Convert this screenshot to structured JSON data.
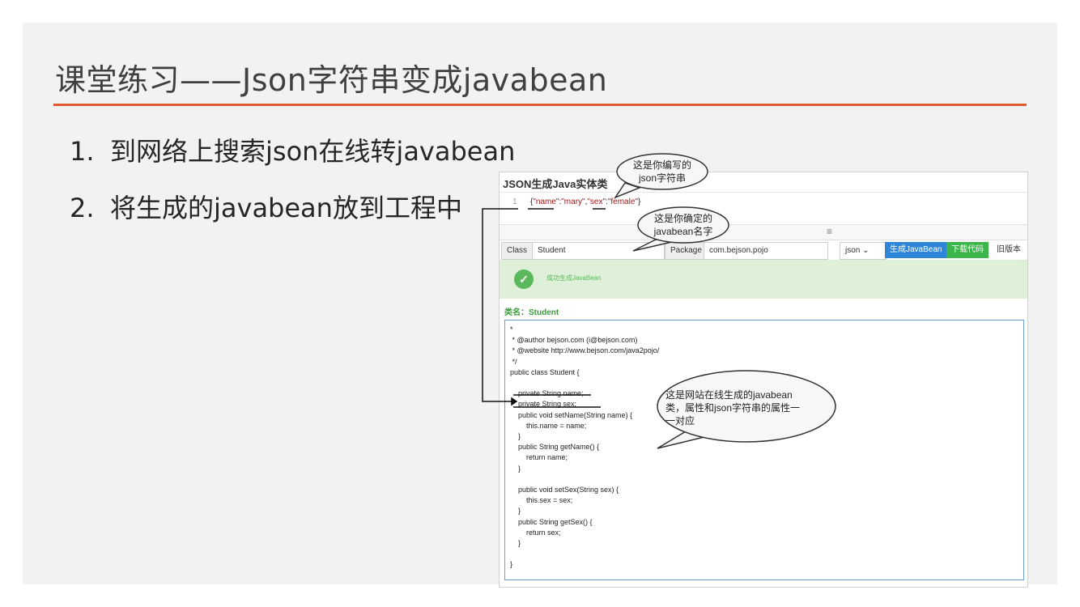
{
  "slide": {
    "title": "课堂练习——Json字符串变成javabean",
    "accent_color": "#e05a2b",
    "bullets": [
      {
        "num": "1.",
        "text": "到网络上搜索json在线转javabean"
      },
      {
        "num": "2.",
        "text": "将生成的javabean放到工程中"
      }
    ]
  },
  "screenshot": {
    "title": "JSON生成Java实体类",
    "editor": {
      "line_number": "1",
      "json_prefix": "{",
      "key1": "\"name\"",
      "sep1": ":",
      "val1": "\"mary\"",
      "comma": ",",
      "key2": "\"sex\"",
      "sep2": ":",
      "val2": "\"female\"",
      "json_suffix": "}"
    },
    "menu_icon": "hamburger-icon",
    "form": {
      "class_label": "Class",
      "class_value": "Student",
      "package_label": "Package",
      "package_value": "com.bejson.pojo",
      "type_select": "json",
      "generate_button": "生成JavaBean",
      "download_button": "下载代码",
      "old_version": "旧版本"
    },
    "success_message": "成功生成JavaBean",
    "class_name_label": "类名：Student",
    "code_lines": [
      "*",
      " * @author bejson.com (i@bejson.com)",
      " * @website http://www.bejson.com/java2pojo/",
      " */",
      "public class Student {",
      "",
      "    private String name;",
      "    private String sex;",
      "    public void setName(String name) {",
      "        this.name = name;",
      "    }",
      "    public String getName() {",
      "        return name;",
      "    }",
      "",
      "    public void setSex(String sex) {",
      "        this.sex = sex;",
      "    }",
      "    public String getSex() {",
      "        return sex;",
      "    }",
      "",
      "}"
    ]
  },
  "callouts": {
    "json": [
      "这是你编写的",
      "json字符串"
    ],
    "javabean_name": [
      "这是你确定的",
      "javabean名字"
    ],
    "generated": [
      "这是网站在线生成的javabean",
      "类，属性和json字符串的属性一",
      "一对应"
    ]
  }
}
